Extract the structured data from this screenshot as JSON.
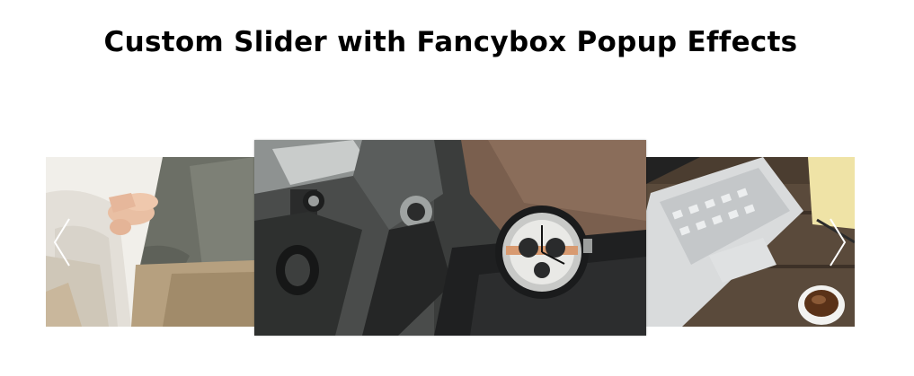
{
  "header": {
    "title": "Custom Slider with Fancybox Popup Effects"
  },
  "slider": {
    "slides": [
      {
        "name": "slide-man-clasped-hands",
        "icon": "photo-person-sitting"
      },
      {
        "name": "slide-wristwatch-motorcycle",
        "icon": "photo-wristwatch"
      },
      {
        "name": "slide-laptop-coffee",
        "icon": "photo-laptop"
      }
    ],
    "controls": {
      "prev_icon": "chevron-left-icon",
      "next_icon": "chevron-right-icon"
    }
  },
  "colors": {
    "background": "#ffffff",
    "title": "#000000",
    "arrow": "#ffffff"
  }
}
